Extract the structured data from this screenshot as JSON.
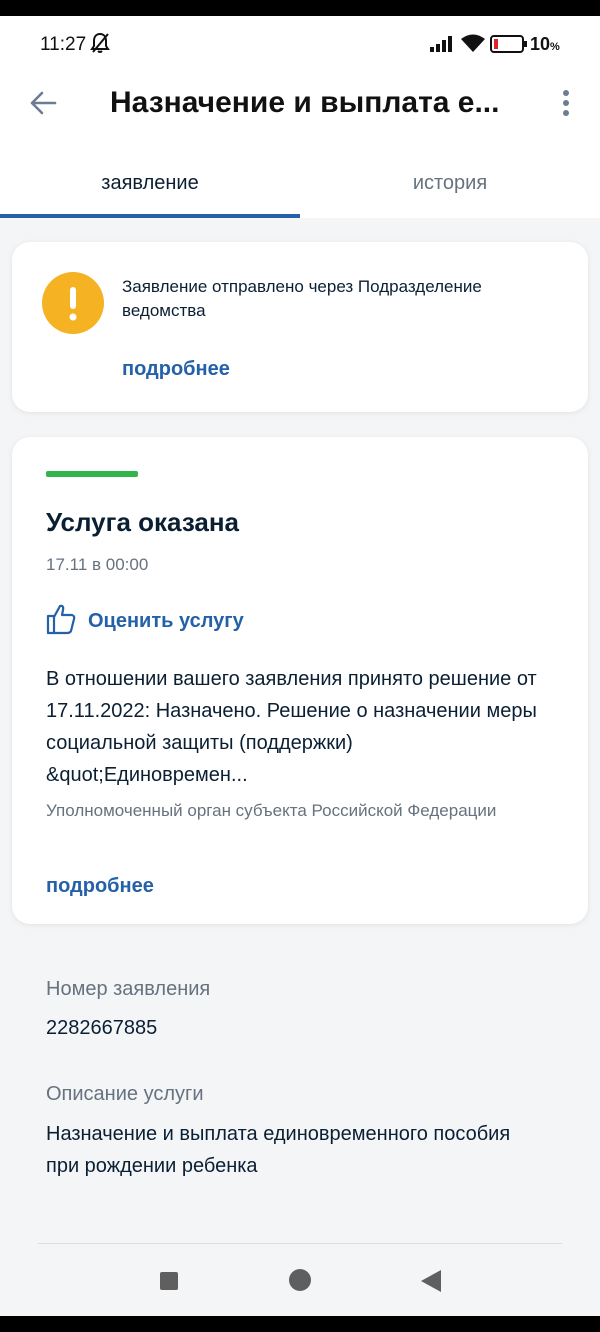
{
  "status_bar": {
    "time": "11:27",
    "battery": "10",
    "battery_unit": "%"
  },
  "header": {
    "title": "Назначение и выплата е..."
  },
  "tabs": [
    {
      "label": "заявление",
      "active": true
    },
    {
      "label": "история",
      "active": false
    }
  ],
  "notice": {
    "text": "Заявление отправлено через Подразделение ведомства",
    "link": "подробнее"
  },
  "status_card": {
    "title": "Услуга оказана",
    "date": "17.11 в 00:00",
    "rate_label": "Оценить услугу",
    "decision": "В отношении вашего заявления принято решение от 17.11.2022: Назначено. Решение о назначении меры социальной защиты (поддержки) &quot;Единовремен...",
    "organization": "Уполномоченный орган субъекта Российской Федерации",
    "link": "подробнее"
  },
  "details": {
    "number_label": "Номер заявления",
    "number_value": "2282667885",
    "description_label": "Описание услуги",
    "description_value": "Назначение и выплата единовременного пособия при рождении ребенка"
  },
  "colors": {
    "accent": "#2461a8",
    "success": "#32b44a",
    "warning": "#f5b324",
    "text": "#0b1f33",
    "muted": "#66727f"
  },
  "icons": [
    "back-arrow-icon",
    "more-vert-icon",
    "exclamation-icon",
    "thumbs-up-icon",
    "bell-off-icon",
    "signal-icon",
    "wifi-icon",
    "battery-icon",
    "nav-recents-icon",
    "nav-home-icon",
    "nav-back-icon"
  ]
}
